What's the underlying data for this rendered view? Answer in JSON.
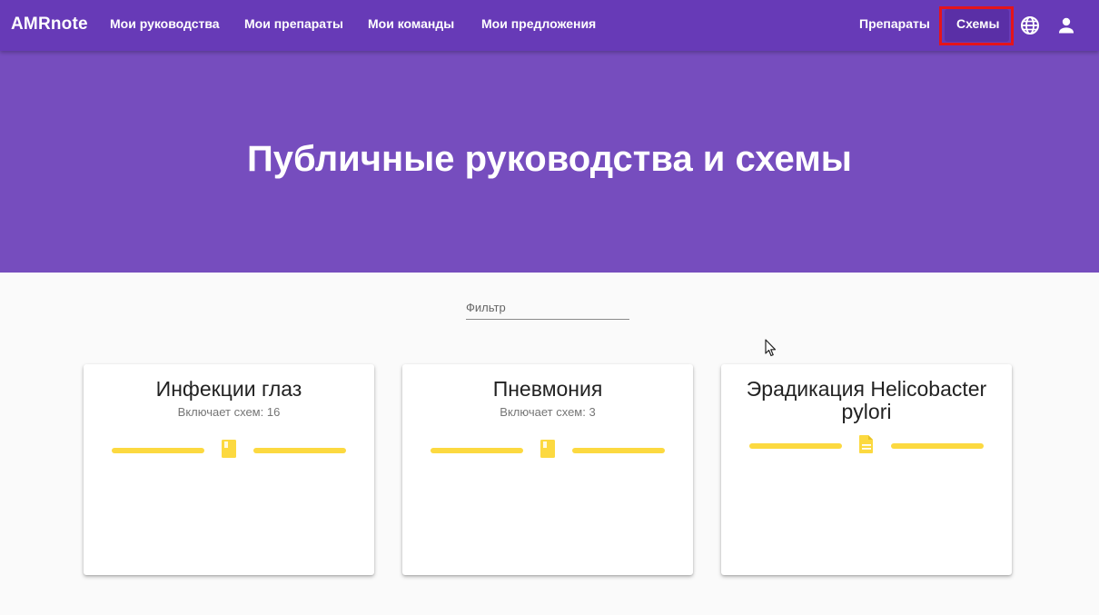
{
  "header": {
    "brand": "AMRnote",
    "nav_left": [
      "Мои руководства",
      "Мои препараты",
      "Мои команды",
      "Мои предложения"
    ],
    "nav_drugs": "Препараты",
    "nav_schemes": "Схемы",
    "icons": {
      "language": "globe-icon",
      "account": "person-icon"
    }
  },
  "hero": {
    "title": "Публичные руководства и схемы"
  },
  "filter": {
    "placeholder": "Фильтр",
    "value": ""
  },
  "cards": [
    {
      "title": "Инфекции глаз",
      "subtitle": "Включает схем: 16",
      "icon": "book-icon"
    },
    {
      "title": "Пневмония",
      "subtitle": "Включает схем: 3",
      "icon": "book-icon"
    },
    {
      "title": "Эрадикация Helicobacter pylori",
      "subtitle": "",
      "icon": "document-icon"
    }
  ],
  "colors": {
    "primary": "#673ab7",
    "hero": "#764dbe",
    "accent": "#fcd940",
    "highlight": "#e5141b"
  }
}
